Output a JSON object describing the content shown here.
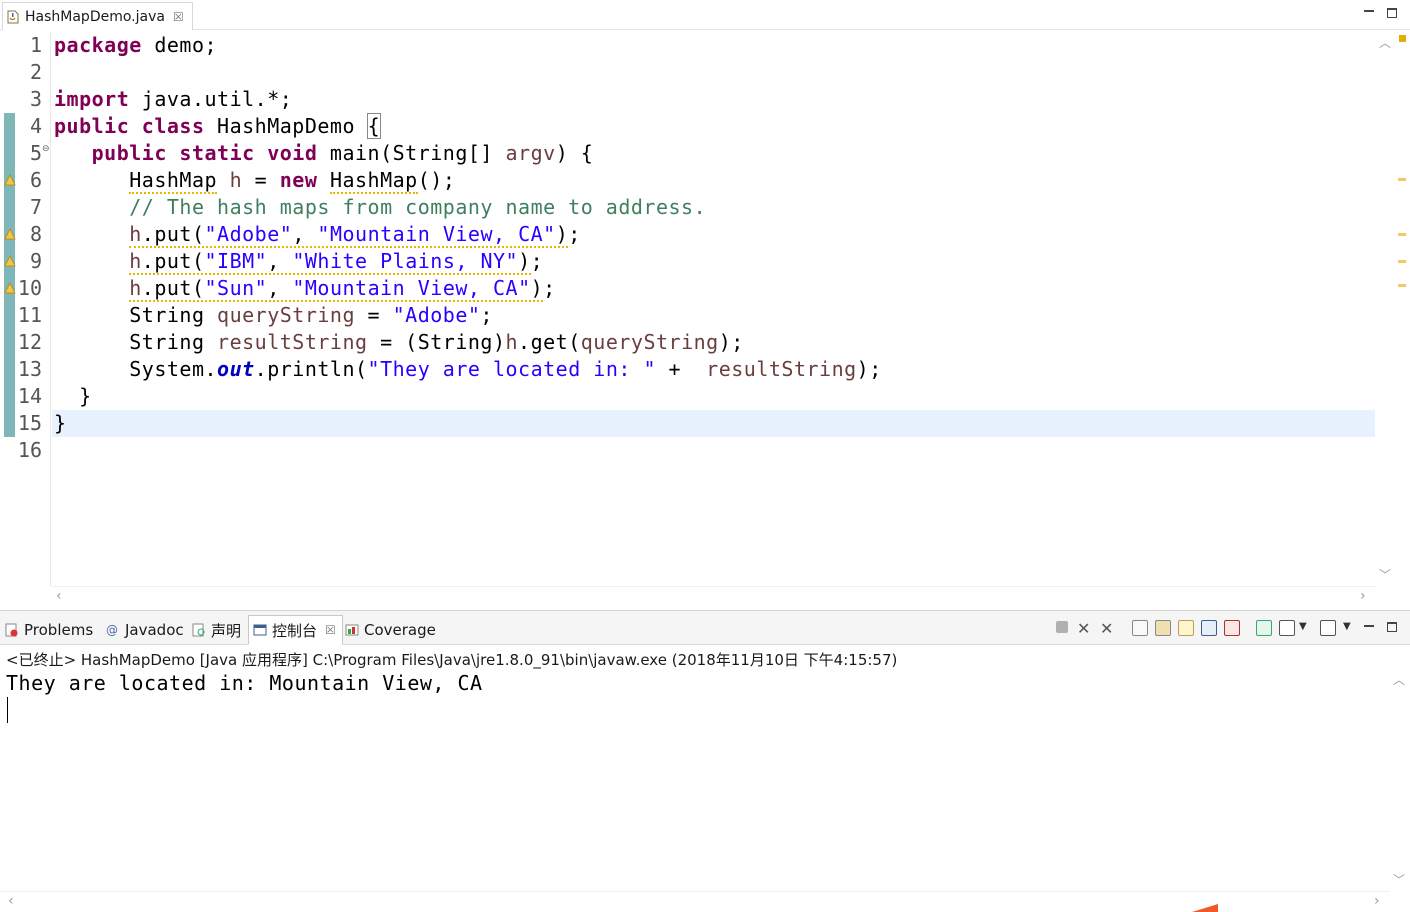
{
  "editor": {
    "tab_label": "HashMapDemo.java",
    "tab_close": "☒",
    "line_numbers": [
      "1",
      "2",
      "3",
      "4",
      "5",
      "6",
      "7",
      "8",
      "9",
      "10",
      "11",
      "12",
      "13",
      "14",
      "15",
      "16"
    ],
    "fold_marker": "⊖"
  },
  "console": {
    "tabs": [
      {
        "label": "Problems",
        "icon": "problems-icon"
      },
      {
        "label": "Javadoc",
        "icon": "javadoc-icon"
      },
      {
        "label": "声明",
        "icon": "declaration-icon"
      },
      {
        "label": "控制台",
        "icon": "console-icon"
      },
      {
        "label": "Coverage",
        "icon": "coverage-icon"
      }
    ],
    "active_tab_close": "☒",
    "launch_info": "<已终止> HashMapDemo [Java 应用程序] C:\\Program Files\\Java\\jre1.8.0_91\\bin\\javaw.exe  (2018年11月10日 下午4:15:57)",
    "output": "They are located in: Mountain View, CA"
  }
}
